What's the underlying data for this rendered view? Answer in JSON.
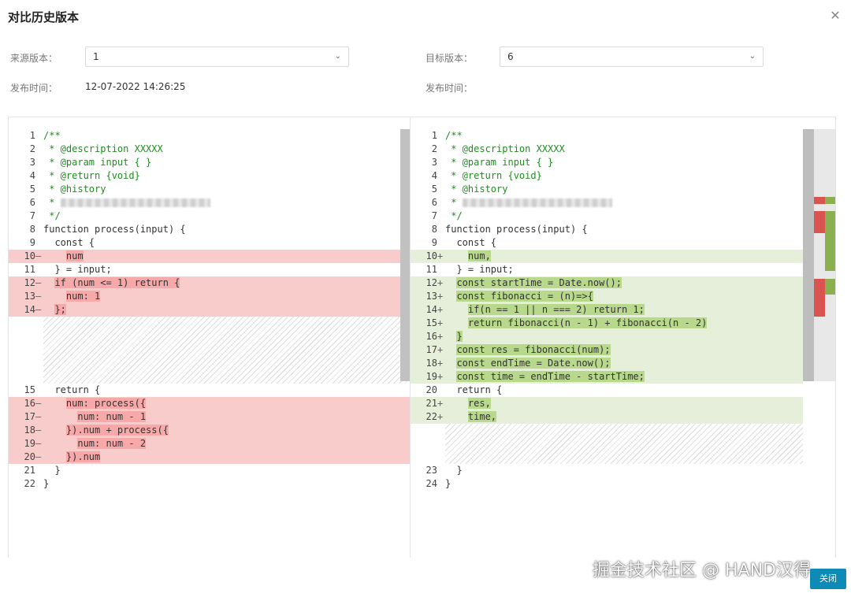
{
  "dialog": {
    "title": "对比历史版本",
    "close_icon": "close-icon",
    "close_button": "关闭"
  },
  "form": {
    "source_label": "来源版本：",
    "source_value": "1",
    "target_label": "目标版本：",
    "target_value": "6",
    "publish_time_label": "发布时间：",
    "publish_time_value": "12-07-2022 14:26:25",
    "target_publish_time_label": "发布时间："
  },
  "diff": {
    "colors": {
      "deleted": "#f9cccc",
      "added": "#e6efd9",
      "deleted_mark": "#f7a8a8",
      "added_mark": "#b8d88c"
    },
    "left_lines": [
      {
        "no": "1",
        "marker": "",
        "code": "/**"
      },
      {
        "no": "2",
        "marker": "",
        "code": " * @description XXXXX"
      },
      {
        "no": "3",
        "marker": "",
        "code": " * @param input { }"
      },
      {
        "no": "4",
        "marker": "",
        "code": " * @return {void}"
      },
      {
        "no": "5",
        "marker": "",
        "code": " * @history"
      },
      {
        "no": "6",
        "marker": "",
        "code": " * "
      },
      {
        "no": "7",
        "marker": "",
        "code": " */"
      },
      {
        "no": "8",
        "marker": "",
        "code": "function process(input) {"
      },
      {
        "no": "9",
        "marker": "",
        "code": "  const {"
      },
      {
        "no": "10",
        "marker": "—",
        "code": "    num"
      },
      {
        "no": "11",
        "marker": "",
        "code": "  } = input;"
      },
      {
        "no": "12",
        "marker": "—",
        "code": "  if (num <= 1) return {"
      },
      {
        "no": "13",
        "marker": "—",
        "code": "    num: 1"
      },
      {
        "no": "14",
        "marker": "—",
        "code": "  };"
      },
      {
        "no": "15",
        "marker": "",
        "code": "  return {"
      },
      {
        "no": "16",
        "marker": "—",
        "code": "    num: process({"
      },
      {
        "no": "17",
        "marker": "—",
        "code": "      num: num - 1"
      },
      {
        "no": "18",
        "marker": "—",
        "code": "    }).num + process({"
      },
      {
        "no": "19",
        "marker": "—",
        "code": "      num: num - 2"
      },
      {
        "no": "20",
        "marker": "—",
        "code": "    }).num"
      },
      {
        "no": "21",
        "marker": "",
        "code": "  }"
      },
      {
        "no": "22",
        "marker": "",
        "code": "}"
      }
    ],
    "right_lines": [
      {
        "no": "1",
        "marker": "",
        "code": "/**"
      },
      {
        "no": "2",
        "marker": "",
        "code": " * @description XXXXX"
      },
      {
        "no": "3",
        "marker": "",
        "code": " * @param input { }"
      },
      {
        "no": "4",
        "marker": "",
        "code": " * @return {void}"
      },
      {
        "no": "5",
        "marker": "",
        "code": " * @history"
      },
      {
        "no": "6",
        "marker": "",
        "code": " * "
      },
      {
        "no": "7",
        "marker": "",
        "code": " */"
      },
      {
        "no": "8",
        "marker": "",
        "code": "function process(input) {"
      },
      {
        "no": "9",
        "marker": "",
        "code": "  const {"
      },
      {
        "no": "10",
        "marker": "+",
        "code": "    num,"
      },
      {
        "no": "11",
        "marker": "",
        "code": "  } = input;"
      },
      {
        "no": "12",
        "marker": "+",
        "code": "  const startTime = Date.now();"
      },
      {
        "no": "13",
        "marker": "+",
        "code": "  const fibonacci = (n)=>{"
      },
      {
        "no": "14",
        "marker": "+",
        "code": "    if(n == 1 || n === 2) return 1;"
      },
      {
        "no": "15",
        "marker": "+",
        "code": "    return fibonacci(n - 1) + fibonacci(n - 2)"
      },
      {
        "no": "16",
        "marker": "+",
        "code": "  }"
      },
      {
        "no": "17",
        "marker": "+",
        "code": "  const res = fibonacci(num);"
      },
      {
        "no": "18",
        "marker": "+",
        "code": "  const endTime = Date.now();"
      },
      {
        "no": "19",
        "marker": "+",
        "code": "  const time = endTime - startTime;"
      },
      {
        "no": "20",
        "marker": "",
        "code": "  return {"
      },
      {
        "no": "21",
        "marker": "+",
        "code": "    res,"
      },
      {
        "no": "22",
        "marker": "+",
        "code": "    time,"
      },
      {
        "no": "23",
        "marker": "",
        "code": "  }"
      },
      {
        "no": "24",
        "marker": "",
        "code": "}"
      }
    ]
  },
  "watermark": "掘金技术社区 @ HAND汉得"
}
